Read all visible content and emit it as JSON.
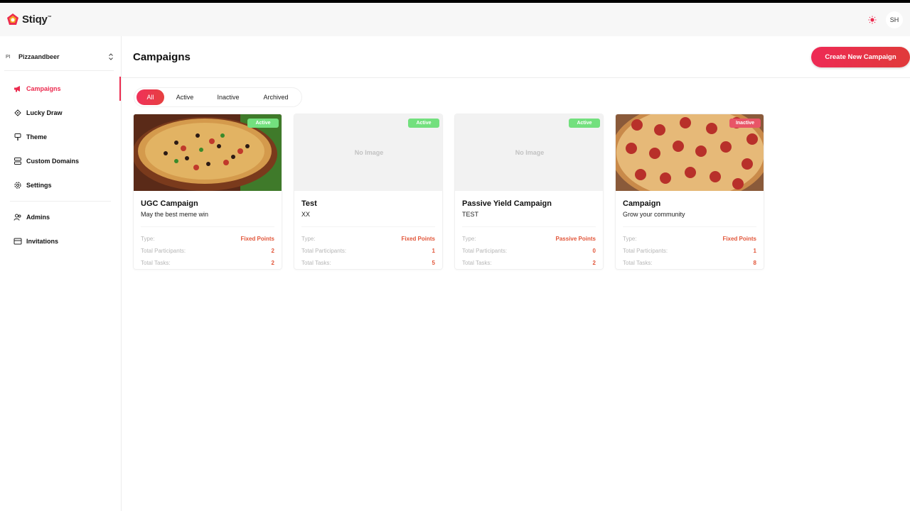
{
  "app": {
    "brand_name": "Stiqy",
    "brand_mark": "™",
    "user_initials": "SH",
    "accent_color": "#ec2b4f"
  },
  "sidebar": {
    "org_initials": "PI",
    "org_name": "Pizzaandbeer",
    "items": [
      {
        "label": "Campaigns",
        "icon": "megaphone-icon",
        "active": true
      },
      {
        "label": "Lucky Draw",
        "icon": "ticket-icon",
        "active": false
      },
      {
        "label": "Theme",
        "icon": "paint-brush-icon",
        "active": false
      },
      {
        "label": "Custom Domains",
        "icon": "domains-icon",
        "active": false
      },
      {
        "label": "Settings",
        "icon": "gear-icon",
        "active": false
      }
    ],
    "secondary_items": [
      {
        "label": "Admins",
        "icon": "users-icon"
      },
      {
        "label": "Invitations",
        "icon": "invitation-icon"
      }
    ]
  },
  "main": {
    "page_title": "Campaigns",
    "create_button": "Create New Campaign",
    "tabs": [
      {
        "label": "All",
        "active": true
      },
      {
        "label": "Active",
        "active": false
      },
      {
        "label": "Inactive",
        "active": false
      },
      {
        "label": "Archived",
        "active": false
      }
    ],
    "labels": {
      "type": "Type:",
      "participants": "Total Participants:",
      "tasks": "Total Tasks:",
      "no_image": "No Image"
    },
    "campaigns": [
      {
        "title": "UGC Campaign",
        "description": "May the best meme win",
        "status": "Active",
        "type": "Fixed Points",
        "participants": "2",
        "tasks": "2",
        "image": "pizza-veggie"
      },
      {
        "title": "Test",
        "description": "XX",
        "status": "Active",
        "type": "Fixed Points",
        "participants": "1",
        "tasks": "5",
        "image": "none"
      },
      {
        "title": "Passive Yield Campaign",
        "description": "TEST",
        "status": "Active",
        "type": "Passive Points",
        "participants": "0",
        "tasks": "2",
        "image": "none"
      },
      {
        "title": "Campaign",
        "description": "Grow your community",
        "status": "Inactive",
        "type": "Fixed Points",
        "participants": "1",
        "tasks": "8",
        "image": "pizza-pepperoni"
      }
    ]
  }
}
